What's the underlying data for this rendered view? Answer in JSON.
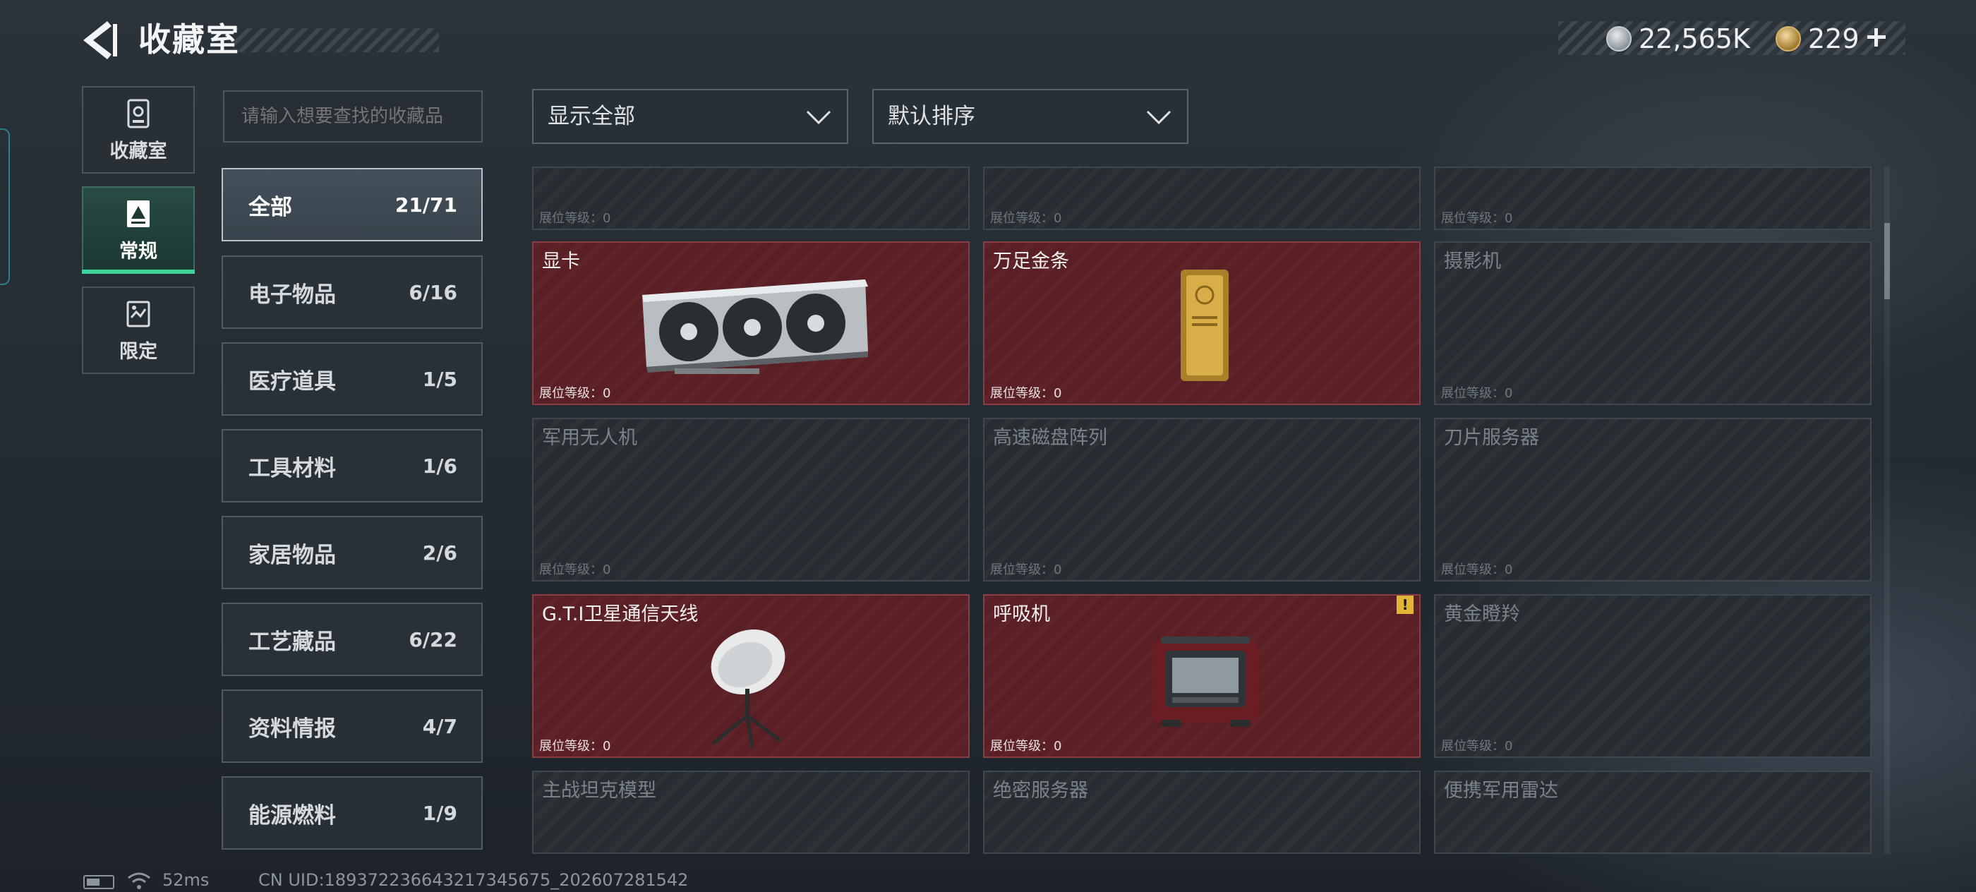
{
  "header": {
    "title": "收藏室",
    "currency_silver": "22,565K",
    "currency_gold": "229"
  },
  "side_tabs": [
    {
      "label": "收藏室",
      "icon": "collection-icon"
    },
    {
      "label": "常规",
      "icon": "regular-icon"
    },
    {
      "label": "限定",
      "icon": "limited-icon"
    }
  ],
  "search": {
    "placeholder": "请输入想要查找的收藏品"
  },
  "categories": [
    {
      "name": "全部",
      "count": "21/71"
    },
    {
      "name": "电子物品",
      "count": "6/16"
    },
    {
      "name": "医疗道具",
      "count": "1/5"
    },
    {
      "name": "工具材料",
      "count": "1/6"
    },
    {
      "name": "家居物品",
      "count": "2/6"
    },
    {
      "name": "工艺藏品",
      "count": "6/22"
    },
    {
      "name": "资料情报",
      "count": "4/7"
    },
    {
      "name": "能源燃料",
      "count": "1/9"
    }
  ],
  "filters": {
    "display": "显示全部",
    "sort": "默认排序"
  },
  "level_label": "展位等级：0",
  "items": [
    {
      "name": "",
      "owned": false
    },
    {
      "name": "",
      "owned": false
    },
    {
      "name": "",
      "owned": false
    },
    {
      "name": "显卡",
      "owned": true
    },
    {
      "name": "万足金条",
      "owned": true
    },
    {
      "name": "摄影机",
      "owned": false
    },
    {
      "name": "军用无人机",
      "owned": false
    },
    {
      "name": "高速磁盘阵列",
      "owned": false
    },
    {
      "name": "刀片服务器",
      "owned": false
    },
    {
      "name": "G.T.I卫星通信天线",
      "owned": true
    },
    {
      "name": "呼吸机",
      "owned": true,
      "badge": "!"
    },
    {
      "name": "黄金瞪羚",
      "owned": false
    },
    {
      "name": "主战坦克模型",
      "owned": false
    },
    {
      "name": "绝密服务器",
      "owned": false
    },
    {
      "name": "便携军用雷达",
      "owned": false
    }
  ],
  "status": {
    "ping": "52ms",
    "uid": "CN UID:18937223664321734567​5_202607281542"
  }
}
